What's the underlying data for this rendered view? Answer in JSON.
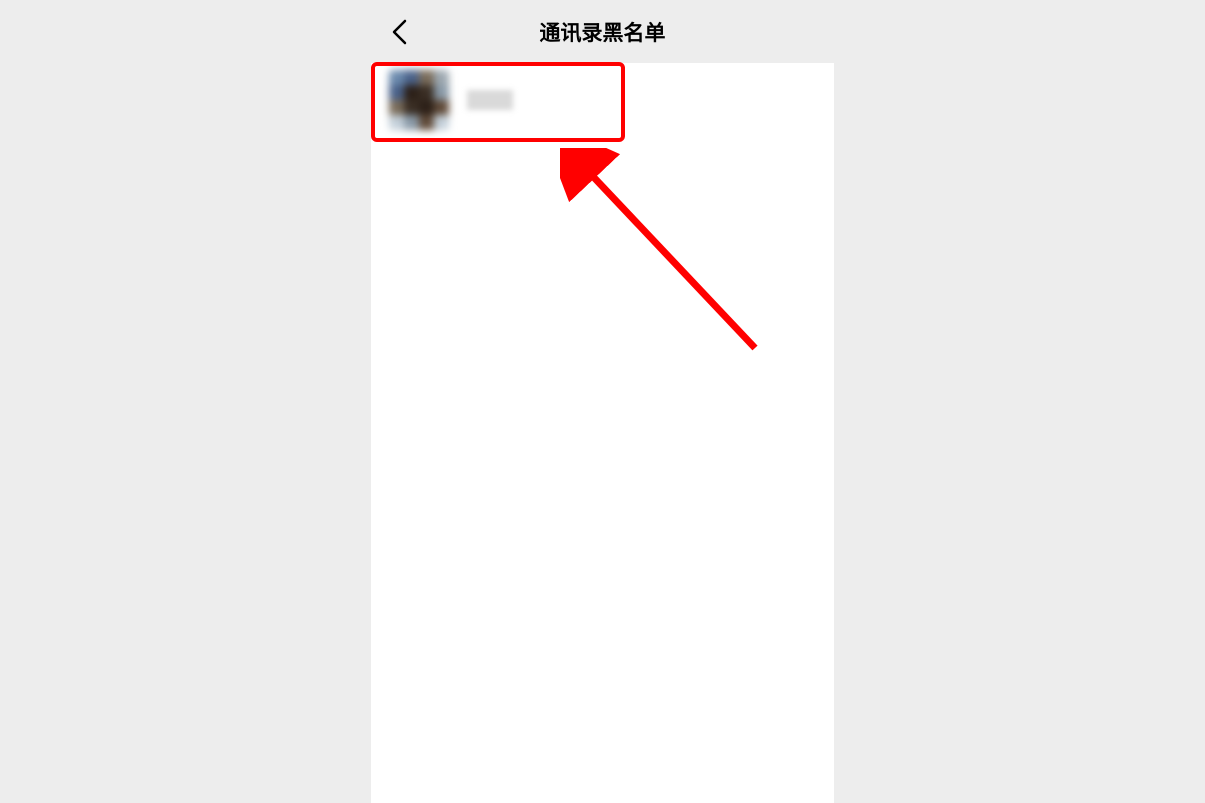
{
  "header": {
    "title": "通讯录黑名单"
  },
  "contacts": [
    {
      "name_redacted": true
    }
  ]
}
